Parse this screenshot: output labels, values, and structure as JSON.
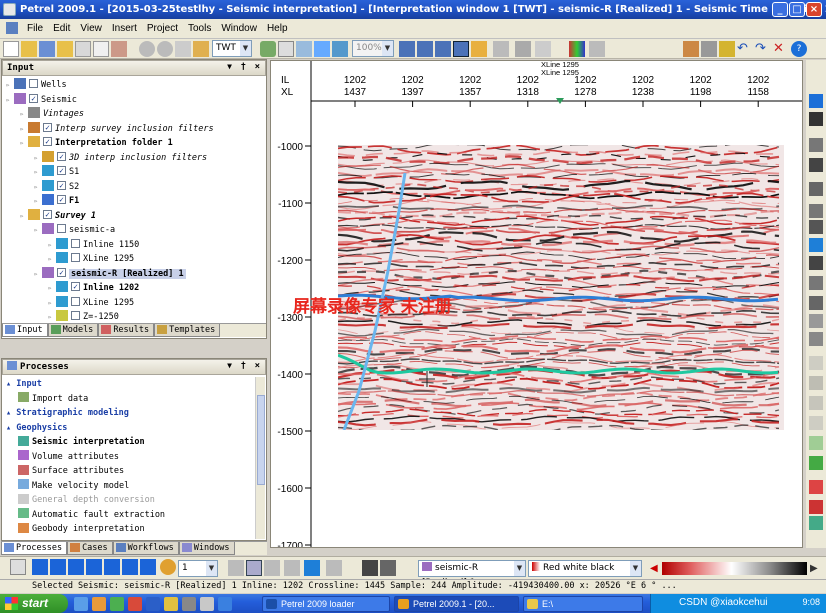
{
  "window": {
    "title": "Petrel 2009.1 - [2015-03-25testlhy - Seismic interpretation] - [Interpretation window 1 [TWT] - seismic-R [Realized] 1 - Seismic Time 2 - Inline 1202]"
  },
  "menu": [
    "File",
    "Edit",
    "View",
    "Insert",
    "Project",
    "Tools",
    "Window",
    "Help"
  ],
  "toolbar": {
    "domain": "TWT",
    "zoom": "100%"
  },
  "input_panel": {
    "title": "Input",
    "tree": [
      {
        "label": "Wells",
        "level": 0,
        "checked": false,
        "italic": false,
        "bold": false
      },
      {
        "label": "Seismic",
        "level": 0,
        "checked": true,
        "italic": false,
        "bold": false
      },
      {
        "label": "Vintages",
        "level": 1,
        "checked": null,
        "italic": true,
        "bold": false
      },
      {
        "label": "Interp survey inclusion filters",
        "level": 1,
        "checked": true,
        "italic": true,
        "bold": false
      },
      {
        "label": "Interpretation folder 1",
        "level": 1,
        "checked": true,
        "italic": false,
        "bold": true
      },
      {
        "label": "3D interp inclusion filters",
        "level": 2,
        "checked": true,
        "italic": true,
        "bold": false
      },
      {
        "label": "S1",
        "level": 2,
        "checked": true,
        "italic": false,
        "bold": false
      },
      {
        "label": "S2",
        "level": 2,
        "checked": true,
        "italic": false,
        "bold": false
      },
      {
        "label": "F1",
        "level": 2,
        "checked": true,
        "italic": false,
        "bold": true
      },
      {
        "label": "Survey 1",
        "level": 1,
        "checked": true,
        "italic": true,
        "bold": true
      },
      {
        "label": "seismic-a",
        "level": 2,
        "checked": false,
        "italic": false,
        "bold": false
      },
      {
        "label": "Inline 1150",
        "level": 3,
        "checked": false,
        "italic": false,
        "bold": false
      },
      {
        "label": "XLine 1295",
        "level": 3,
        "checked": false,
        "italic": false,
        "bold": false
      },
      {
        "label": "seismic-R [Realized] 1",
        "level": 2,
        "checked": true,
        "italic": false,
        "bold": true
      },
      {
        "label": "Inline 1202",
        "level": 3,
        "checked": true,
        "italic": false,
        "bold": true
      },
      {
        "label": "XLine 1295",
        "level": 3,
        "checked": false,
        "italic": false,
        "bold": false
      },
      {
        "label": "Z=-1250",
        "level": 3,
        "checked": false,
        "italic": false,
        "bold": false
      }
    ],
    "tabs": [
      "Input",
      "Models",
      "Results",
      "Templates"
    ]
  },
  "process_panel": {
    "title": "Processes",
    "items": [
      {
        "label": "Input",
        "type": "hdr"
      },
      {
        "label": "Import data",
        "type": "item"
      },
      {
        "label": "Stratigraphic modeling",
        "type": "hdr"
      },
      {
        "label": "Geophysics",
        "type": "hdr"
      },
      {
        "label": "Seismic interpretation",
        "type": "bold"
      },
      {
        "label": "Volume attributes",
        "type": "item"
      },
      {
        "label": "Surface attributes",
        "type": "item"
      },
      {
        "label": "Make velocity model",
        "type": "item"
      },
      {
        "label": "General depth conversion",
        "type": "dim"
      },
      {
        "label": "Automatic fault extraction",
        "type": "item"
      },
      {
        "label": "Geobody interpretation",
        "type": "item"
      }
    ],
    "tabs": [
      "Processes",
      "Cases",
      "Workflows",
      "Windows"
    ]
  },
  "view": {
    "axis_labels": {
      "il": "IL",
      "xl": "XL"
    },
    "top_ticks": [
      {
        "il": "1202",
        "xl": "1437"
      },
      {
        "il": "1202",
        "xl": "1397"
      },
      {
        "il": "1202",
        "xl": "1357"
      },
      {
        "il": "1202",
        "xl": "1318"
      },
      {
        "il": "1202",
        "xl": "1278"
      },
      {
        "il": "1202",
        "xl": "1238"
      },
      {
        "il": "1202",
        "xl": "1198"
      },
      {
        "il": "1202",
        "xl": "1158"
      }
    ],
    "xline_marker": [
      "XLine 1295",
      "XLine 1295"
    ],
    "depth_ticks": [
      "-1000",
      "-1100",
      "-1200",
      "-1300",
      "-1400",
      "-1500",
      "-1600",
      "-1700"
    ],
    "watermark": "屏幕录像专家 未注册",
    "colors": {
      "horizon_s1": "#2e7fd6",
      "horizon_s2": "#1fc8a0",
      "fault_f1": "#6ab6ee"
    }
  },
  "bottom_toolbar": {
    "step": "1",
    "seismic": "seismic-R [Realized] 1",
    "colortable": "Red white black"
  },
  "status": "Selected Seismic: seismic-R [Realized] 1  Inline: 1202 Crossline: 1445 Sample: 244  Amplitude: -419430400.00  x: 20526 °E 6 ° ...",
  "taskbar": {
    "start": "start",
    "tasks": [
      "Petrel 2009 loader",
      "Petrel 2009.1 - [20...",
      "E:\\"
    ],
    "clock": "9:08",
    "csdn": "CSDN @xiaokcehui"
  }
}
